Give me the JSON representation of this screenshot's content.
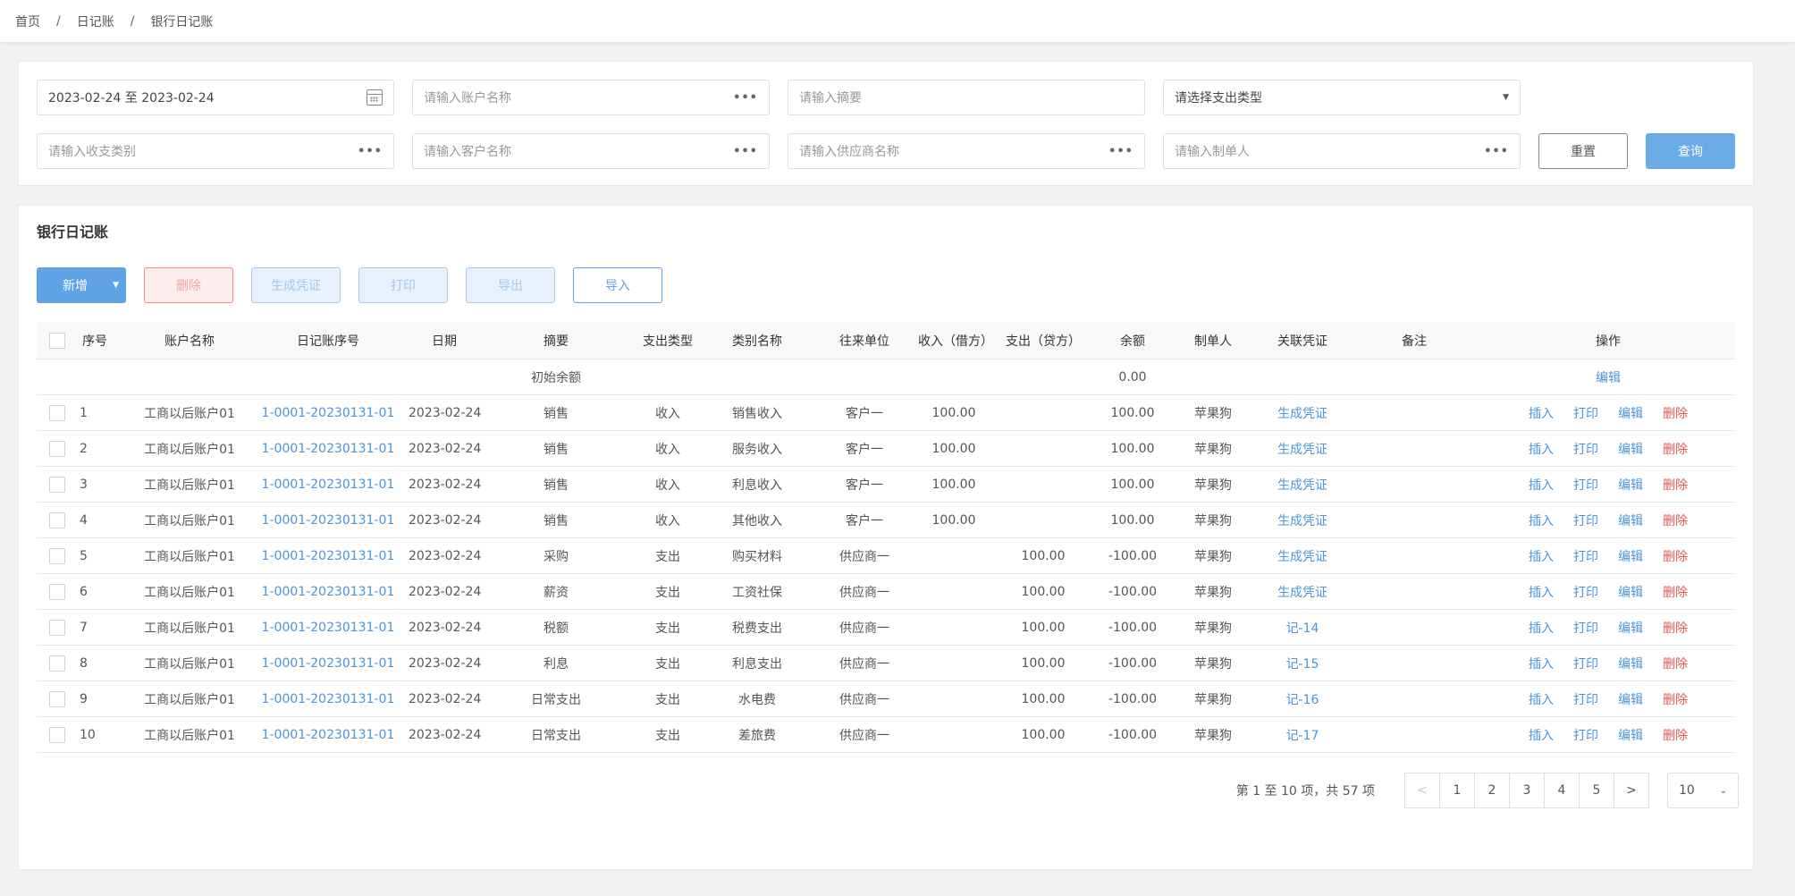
{
  "breadcrumb": {
    "home": "首页",
    "level2": "日记账",
    "current": "银行日记账",
    "sep": "/"
  },
  "filters": {
    "date_range": "2023-02-24 至 2023-02-24",
    "account_placeholder": "请输入账户名称",
    "summary_placeholder": "请输入摘要",
    "expense_type_placeholder": "请选择支出类型",
    "category_placeholder": "请输入收支类别",
    "customer_placeholder": "请输入客户名称",
    "supplier_placeholder": "请输入供应商名称",
    "creator_placeholder": "请输入制单人",
    "reset_label": "重置",
    "query_label": "查询"
  },
  "list": {
    "title": "银行日记账",
    "toolbar": {
      "add": "新增",
      "delete": "删除",
      "gen_voucher": "生成凭证",
      "print": "打印",
      "export": "导出",
      "import": "导入"
    },
    "headers": {
      "seq": "序号",
      "account": "账户名称",
      "journal_no": "日记账序号",
      "date": "日期",
      "summary": "摘要",
      "exp_type": "支出类型",
      "category": "类别名称",
      "partner": "往来单位",
      "income": "收入（借方）",
      "expense": "支出（贷方）",
      "balance": "余额",
      "creator": "制单人",
      "voucher": "关联凭证",
      "remark": "备注",
      "ops": "操作"
    },
    "opening": {
      "label": "初始余额",
      "balance": "0.00",
      "edit": "编辑"
    },
    "op_labels": {
      "insert": "插入",
      "print": "打印",
      "edit": "编辑",
      "delete": "删除"
    },
    "rows": [
      {
        "seq": "1",
        "account": "工商以后账户01",
        "journal_no": "1-0001-20230131-01",
        "date": "2023-02-24",
        "summary": "销售",
        "exp_type": "收入",
        "category": "销售收入",
        "partner": "客户一",
        "income": "100.00",
        "expense": "",
        "balance": "100.00",
        "creator": "苹果狗",
        "voucher": "生成凭证"
      },
      {
        "seq": "2",
        "account": "工商以后账户01",
        "journal_no": "1-0001-20230131-01",
        "date": "2023-02-24",
        "summary": "销售",
        "exp_type": "收入",
        "category": "服务收入",
        "partner": "客户一",
        "income": "100.00",
        "expense": "",
        "balance": "100.00",
        "creator": "苹果狗",
        "voucher": "生成凭证"
      },
      {
        "seq": "3",
        "account": "工商以后账户01",
        "journal_no": "1-0001-20230131-01",
        "date": "2023-02-24",
        "summary": "销售",
        "exp_type": "收入",
        "category": "利息收入",
        "partner": "客户一",
        "income": "100.00",
        "expense": "",
        "balance": "100.00",
        "creator": "苹果狗",
        "voucher": "生成凭证"
      },
      {
        "seq": "4",
        "account": "工商以后账户01",
        "journal_no": "1-0001-20230131-01",
        "date": "2023-02-24",
        "summary": "销售",
        "exp_type": "收入",
        "category": "其他收入",
        "partner": "客户一",
        "income": "100.00",
        "expense": "",
        "balance": "100.00",
        "creator": "苹果狗",
        "voucher": "生成凭证"
      },
      {
        "seq": "5",
        "account": "工商以后账户01",
        "journal_no": "1-0001-20230131-01",
        "date": "2023-02-24",
        "summary": "采购",
        "exp_type": "支出",
        "category": "购买材料",
        "partner": "供应商一",
        "income": "",
        "expense": "100.00",
        "balance": "-100.00",
        "creator": "苹果狗",
        "voucher": "生成凭证"
      },
      {
        "seq": "6",
        "account": "工商以后账户01",
        "journal_no": "1-0001-20230131-01",
        "date": "2023-02-24",
        "summary": "薪资",
        "exp_type": "支出",
        "category": "工资社保",
        "partner": "供应商一",
        "income": "",
        "expense": "100.00",
        "balance": "-100.00",
        "creator": "苹果狗",
        "voucher": "生成凭证"
      },
      {
        "seq": "7",
        "account": "工商以后账户01",
        "journal_no": "1-0001-20230131-01",
        "date": "2023-02-24",
        "summary": "税额",
        "exp_type": "支出",
        "category": "税费支出",
        "partner": "供应商一",
        "income": "",
        "expense": "100.00",
        "balance": "-100.00",
        "creator": "苹果狗",
        "voucher": "记-14"
      },
      {
        "seq": "8",
        "account": "工商以后账户01",
        "journal_no": "1-0001-20230131-01",
        "date": "2023-02-24",
        "summary": "利息",
        "exp_type": "支出",
        "category": "利息支出",
        "partner": "供应商一",
        "income": "",
        "expense": "100.00",
        "balance": "-100.00",
        "creator": "苹果狗",
        "voucher": "记-15"
      },
      {
        "seq": "9",
        "account": "工商以后账户01",
        "journal_no": "1-0001-20230131-01",
        "date": "2023-02-24",
        "summary": "日常支出",
        "exp_type": "支出",
        "category": "水电费",
        "partner": "供应商一",
        "income": "",
        "expense": "100.00",
        "balance": "-100.00",
        "creator": "苹果狗",
        "voucher": "记-16"
      },
      {
        "seq": "10",
        "account": "工商以后账户01",
        "journal_no": "1-0001-20230131-01",
        "date": "2023-02-24",
        "summary": "日常支出",
        "exp_type": "支出",
        "category": "差旅费",
        "partner": "供应商一",
        "income": "",
        "expense": "100.00",
        "balance": "-100.00",
        "creator": "苹果狗",
        "voucher": "记-17"
      }
    ]
  },
  "pagination": {
    "info": "第 1 至 10 项，共 57 项",
    "prev": "<",
    "next": ">",
    "pages": [
      "1",
      "2",
      "3",
      "4",
      "5"
    ],
    "page_size": "10"
  }
}
